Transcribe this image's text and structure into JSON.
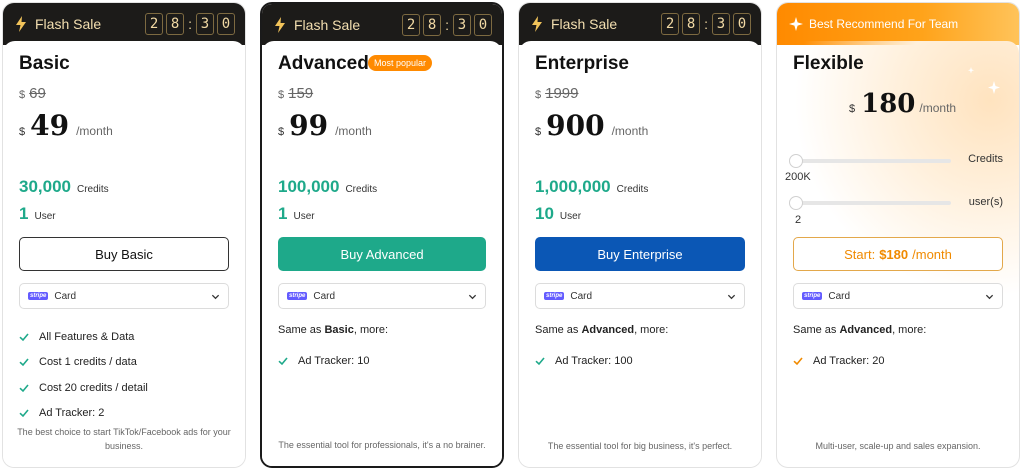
{
  "plans": [
    {
      "banner": {
        "title": "Flash Sale",
        "timer": [
          "2",
          "8",
          "3",
          "0"
        ]
      },
      "name": "Basic",
      "original": {
        "currency": "$",
        "value": "69"
      },
      "price": {
        "currency": "$",
        "amount": "49",
        "period": "/month"
      },
      "credits": {
        "value": "30,000",
        "label": "Credits"
      },
      "users": {
        "value": "1",
        "label": "User"
      },
      "buy_label": "Buy Basic",
      "payment": {
        "badge": "stripe",
        "method": "Card"
      },
      "features": [
        "All Features & Data",
        "Cost 1 credits / data",
        "Cost 20 credits / detail",
        "Ad Tracker: 2"
      ],
      "footer": "The best choice to start TikTok/Facebook ads for your business."
    },
    {
      "banner": {
        "title": "Flash Sale",
        "timer": [
          "2",
          "8",
          "3",
          "0"
        ]
      },
      "name": "Advanced",
      "badge": "Most popular",
      "original": {
        "currency": "$",
        "value": "159"
      },
      "price": {
        "currency": "$",
        "amount": "99",
        "period": "/month"
      },
      "credits": {
        "value": "100,000",
        "label": "Credits"
      },
      "users": {
        "value": "1",
        "label": "User"
      },
      "buy_label": "Buy Advanced",
      "payment": {
        "badge": "stripe",
        "method": "Card"
      },
      "same_as": {
        "prefix": "Same as",
        "plan": "Basic",
        "suffix": ", more:"
      },
      "features": [
        "Ad Tracker: 10"
      ],
      "footer": "The essential tool for professionals, it's a no brainer."
    },
    {
      "banner": {
        "title": "Flash Sale",
        "timer": [
          "2",
          "8",
          "3",
          "0"
        ]
      },
      "name": "Enterprise",
      "original": {
        "currency": "$",
        "value": "1999"
      },
      "price": {
        "currency": "$",
        "amount": "900",
        "period": "/month"
      },
      "credits": {
        "value": "1,000,000",
        "label": "Credits"
      },
      "users": {
        "value": "10",
        "label": "User"
      },
      "buy_label": "Buy Enterprise",
      "payment": {
        "badge": "stripe",
        "method": "Card"
      },
      "same_as": {
        "prefix": "Same as",
        "plan": "Advanced",
        "suffix": ", more:"
      },
      "features": [
        "Ad Tracker: 100"
      ],
      "footer": "The essential tool for big business, it's perfect."
    },
    {
      "banner": {
        "title": "Best Recommend For Team"
      },
      "name": "Flexible",
      "price": {
        "currency": "$",
        "amount": "180",
        "period": "/month"
      },
      "credits_slider": {
        "label": "Credits",
        "value": "200K",
        "level": 0
      },
      "users_slider": {
        "label": "user(s)",
        "value": "2",
        "level": 0
      },
      "start": {
        "prefix": "Start:",
        "amount": "$180",
        "period": "/month"
      },
      "payment": {
        "badge": "stripe",
        "method": "Card"
      },
      "same_as": {
        "prefix": "Same as",
        "plan": "Advanced",
        "suffix": ", more:"
      },
      "features": [
        "Ad Tracker: 20"
      ],
      "footer": "Multi-user, scale-up and sales expansion."
    }
  ],
  "colors": {
    "accent_green": "#1ea98a",
    "enterprise_blue": "#0b57b5",
    "flexible_orange": "#ff8a00",
    "banner_dark": "#1c1b19",
    "banner_gold": "#f1d9a4"
  },
  "icons": {
    "banner": "lightning-bolt-icon",
    "team_banner": "sparkle-icon",
    "feature": "check-icon",
    "dropdown": "chevron-down-icon"
  }
}
